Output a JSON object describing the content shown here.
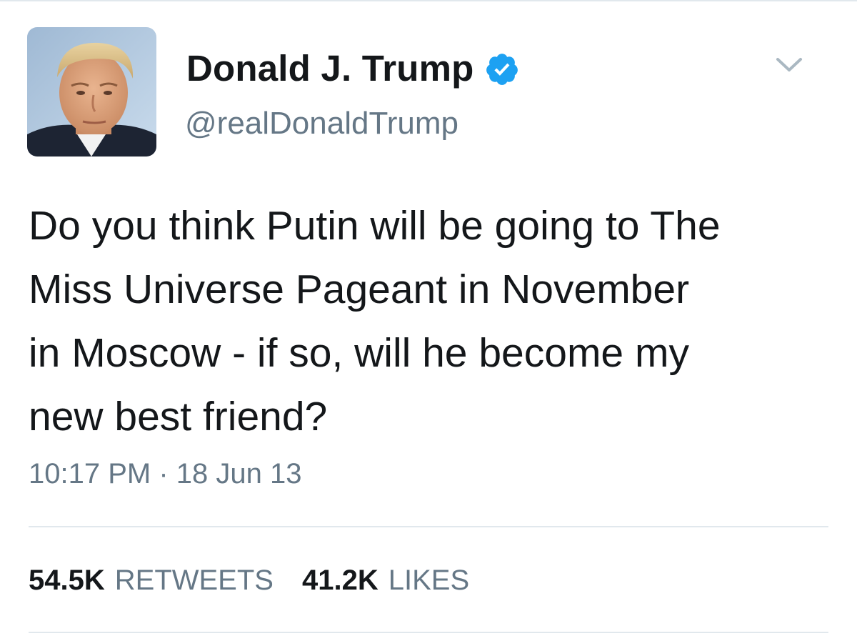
{
  "tweet": {
    "author": {
      "display_name": "Donald J. Trump",
      "screen_name": "@realDonaldTrump",
      "verified": true,
      "verified_color": "#1da1f2"
    },
    "text": "Do you think Putin will be going to The\nMiss Universe Pageant in November\nin Moscow - if so, will he become my\nnew best friend?",
    "timestamp": "10:17 PM · 18 Jun 13",
    "stats": {
      "retweets_count": "54.5K",
      "retweets_label": "RETWEETS",
      "likes_count": "41.2K",
      "likes_label": "LIKES"
    },
    "menu_icon": "chevron-down-icon"
  },
  "colors": {
    "text_primary": "#14171a",
    "text_secondary": "#657786",
    "divider": "#e1e8ed"
  }
}
